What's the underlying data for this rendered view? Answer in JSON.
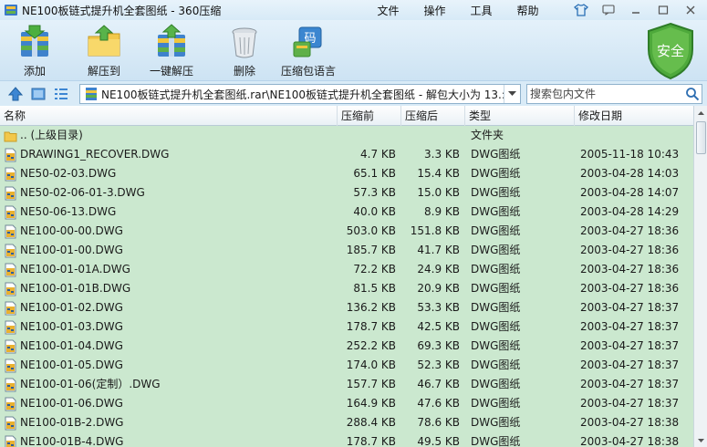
{
  "window": {
    "title": "NE100板链式提升机全套图纸 - 360压缩",
    "menus": [
      "文件",
      "操作",
      "工具",
      "帮助"
    ]
  },
  "toolbar": {
    "items": [
      {
        "label": "添加",
        "icon": "add-icon"
      },
      {
        "label": "解压到",
        "icon": "extract-to-icon"
      },
      {
        "label": "一键解压",
        "icon": "one-click-extract-icon"
      },
      {
        "label": "删除",
        "icon": "delete-icon"
      },
      {
        "label": "压缩包语言",
        "icon": "archive-language-icon"
      }
    ],
    "security_badge": "安全"
  },
  "address": {
    "path": "NE100板链式提升机全套图纸.rar\\NE100板链式提升机全套图纸 - 解包大小为 13.:",
    "search_placeholder": "搜索包内文件"
  },
  "columns": {
    "name": "名称",
    "compressed_before": "压缩前",
    "compressed_after": "压缩后",
    "type": "类型",
    "modified": "修改日期"
  },
  "files": [
    {
      "name": ".. (上级目录)",
      "before": "",
      "after": "",
      "type": "文件夹",
      "date": "",
      "kind": "folder"
    },
    {
      "name": "DRAWING1_RECOVER.DWG",
      "before": "4.7 KB",
      "after": "3.3 KB",
      "type": "DWG图纸",
      "date": "2005-11-18 10:43",
      "kind": "dwg"
    },
    {
      "name": "NE50-02-03.DWG",
      "before": "65.1 KB",
      "after": "15.4 KB",
      "type": "DWG图纸",
      "date": "2003-04-28 14:03",
      "kind": "dwg"
    },
    {
      "name": "NE50-02-06-01-3.DWG",
      "before": "57.3 KB",
      "after": "15.0 KB",
      "type": "DWG图纸",
      "date": "2003-04-28 14:07",
      "kind": "dwg"
    },
    {
      "name": "NE50-06-13.DWG",
      "before": "40.0 KB",
      "after": "8.9 KB",
      "type": "DWG图纸",
      "date": "2003-04-28 14:29",
      "kind": "dwg"
    },
    {
      "name": "NE100-00-00.DWG",
      "before": "503.0 KB",
      "after": "151.8 KB",
      "type": "DWG图纸",
      "date": "2003-04-27 18:36",
      "kind": "dwg"
    },
    {
      "name": "NE100-01-00.DWG",
      "before": "185.7 KB",
      "after": "41.7 KB",
      "type": "DWG图纸",
      "date": "2003-04-27 18:36",
      "kind": "dwg"
    },
    {
      "name": "NE100-01-01A.DWG",
      "before": "72.2 KB",
      "after": "24.9 KB",
      "type": "DWG图纸",
      "date": "2003-04-27 18:36",
      "kind": "dwg"
    },
    {
      "name": "NE100-01-01B.DWG",
      "before": "81.5 KB",
      "after": "20.9 KB",
      "type": "DWG图纸",
      "date": "2003-04-27 18:36",
      "kind": "dwg"
    },
    {
      "name": "NE100-01-02.DWG",
      "before": "136.2 KB",
      "after": "53.3 KB",
      "type": "DWG图纸",
      "date": "2003-04-27 18:37",
      "kind": "dwg"
    },
    {
      "name": "NE100-01-03.DWG",
      "before": "178.7 KB",
      "after": "42.5 KB",
      "type": "DWG图纸",
      "date": "2003-04-27 18:37",
      "kind": "dwg"
    },
    {
      "name": "NE100-01-04.DWG",
      "before": "252.2 KB",
      "after": "69.3 KB",
      "type": "DWG图纸",
      "date": "2003-04-27 18:37",
      "kind": "dwg"
    },
    {
      "name": "NE100-01-05.DWG",
      "before": "174.0 KB",
      "after": "52.3 KB",
      "type": "DWG图纸",
      "date": "2003-04-27 18:37",
      "kind": "dwg"
    },
    {
      "name": "NE100-01-06(定制）.DWG",
      "before": "157.7 KB",
      "after": "46.7 KB",
      "type": "DWG图纸",
      "date": "2003-04-27 18:37",
      "kind": "dwg"
    },
    {
      "name": "NE100-01-06.DWG",
      "before": "164.9 KB",
      "after": "47.6 KB",
      "type": "DWG图纸",
      "date": "2003-04-27 18:37",
      "kind": "dwg"
    },
    {
      "name": "NE100-01B-2.DWG",
      "before": "288.4 KB",
      "after": "78.6 KB",
      "type": "DWG图纸",
      "date": "2003-04-27 18:38",
      "kind": "dwg"
    },
    {
      "name": "NE100-01B-4.DWG",
      "before": "178.7 KB",
      "after": "49.5 KB",
      "type": "DWG图纸",
      "date": "2003-04-27 18:38",
      "kind": "dwg"
    }
  ]
}
